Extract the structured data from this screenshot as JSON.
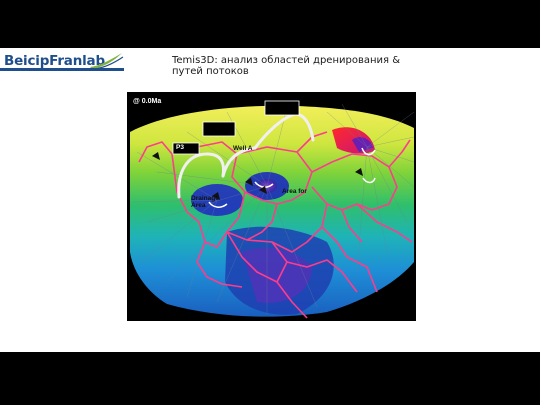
{
  "header": {
    "logo_text": "BeicipFranlab",
    "title": "Temis3D: анализ областей дренирования & путей потоков"
  },
  "figure": {
    "time_label": "@ 0.0Ma",
    "labels": {
      "well_a": "Well A",
      "p3": "P3",
      "drainage": "Drainage Area",
      "area_for": "Area for"
    }
  },
  "colors": {
    "bars": "#000000",
    "logo_blue": "#1f4e8c",
    "logo_green": "#7fb241",
    "migration_paths": "#ff3c8c"
  }
}
